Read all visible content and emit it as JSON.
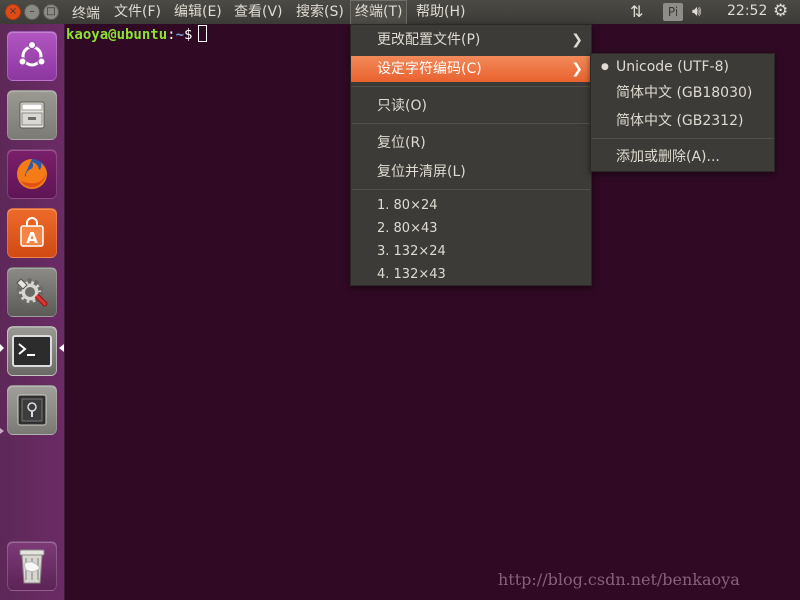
{
  "panel": {
    "app_title": "终端",
    "menus": [
      "文件(F)",
      "编辑(E)",
      "查看(V)",
      "搜索(S)",
      "终端(T)",
      "帮助(H)"
    ],
    "tray_pi": "Pi",
    "clock": "22:52"
  },
  "window_controls": {
    "close": "×",
    "minimize": "–",
    "maximize": "□"
  },
  "terminal": {
    "user_host": "kaoya@ubuntu",
    "separator": ":",
    "path": "~",
    "prompt_symbol": "$"
  },
  "terminal_menu": {
    "items": [
      "更改配置文件(P)",
      "设定字符编码(C)",
      "只读(O)",
      "复位(R)",
      "复位并清屏(L)",
      "1. 80×24",
      "2. 80×43",
      "3. 132×24",
      "4. 132×43"
    ],
    "highlighted": "设定字符编码(C)"
  },
  "encoding_submenu": {
    "items": [
      "Unicode (UTF-8)",
      "简体中文 (GB18030)",
      "简体中文 (GB2312)",
      "添加或删除(A)..."
    ],
    "selected": "Unicode (UTF-8)"
  },
  "watermark": "http://blog.csdn.net/benkaoya",
  "colors": {
    "desktop": "#300a24",
    "highlight": "#e8622f",
    "menu_bg": "#3c3b37",
    "launcher": "#6b2b66"
  }
}
